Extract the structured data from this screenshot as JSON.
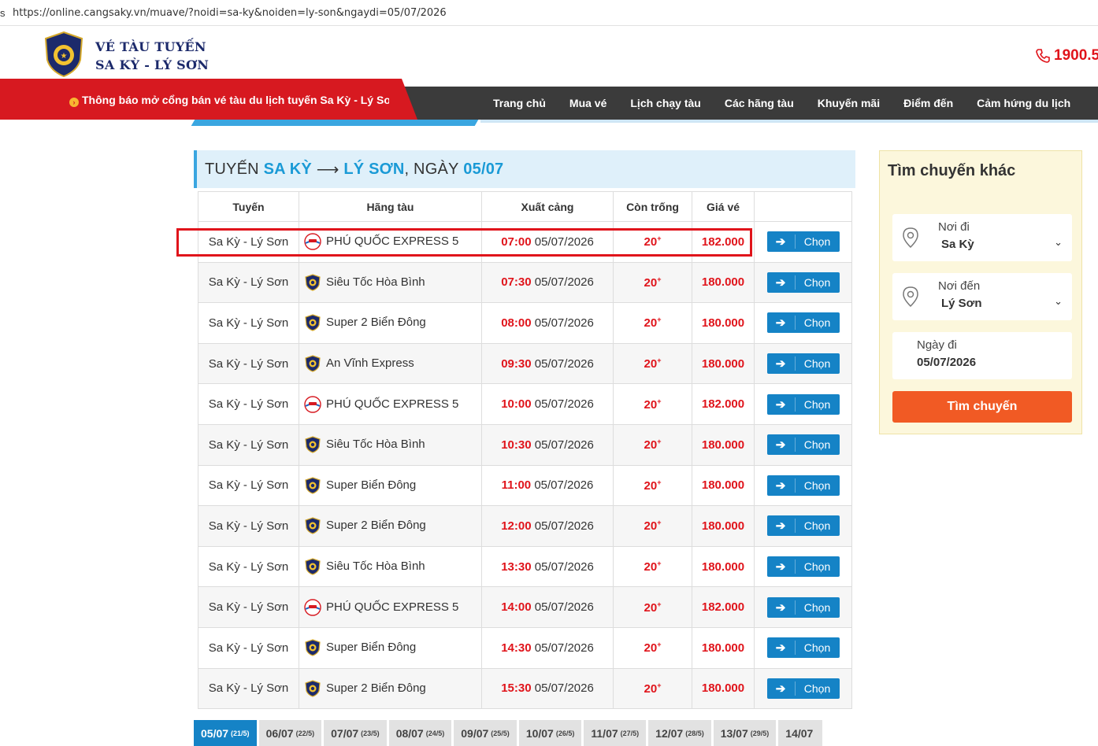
{
  "browser": {
    "url": "https://online.cangsaky.vn/muave/?noidi=sa-ky&noiden=ly-son&ngaydi=05/07/2026"
  },
  "brand": {
    "line1": "VÉ TÀU TUYẾN",
    "line2": "SA KỲ - LÝ SƠN",
    "hotline": "1900.5"
  },
  "notice": "Thông báo mở cổng bán vé tàu du lịch tuyến Sa Kỳ - Lý Sơn",
  "nav": [
    "Trang chủ",
    "Mua vé",
    "Lịch chạy tàu",
    "Các hãng tàu",
    "Khuyến mãi",
    "Điểm đến",
    "Cảm hứng du lịch"
  ],
  "route_title": {
    "prefix": "TUYẾN",
    "from": "SA KỲ",
    "arrow": "⟶",
    "to": "LÝ SƠN",
    "mid": ", NGÀY",
    "date": "05/07"
  },
  "table": {
    "headers": [
      "Tuyến",
      "Hãng tàu",
      "Xuất cảng",
      "Còn trống",
      "Giá vé"
    ],
    "select_label": "Chọn",
    "rows": [
      {
        "route": "Sa Kỳ - Lý Sơn",
        "operator": "PHÚ QUỐC EXPRESS 5",
        "logo": "pq-logo-icon",
        "time": "07:00",
        "date": "05/07/2026",
        "seats": "20",
        "price": "182.000"
      },
      {
        "route": "Sa Kỳ - Lý Sơn",
        "operator": "Siêu Tốc Hòa Bình",
        "logo": "shield-logo-icon",
        "time": "07:30",
        "date": "05/07/2026",
        "seats": "20",
        "price": "180.000"
      },
      {
        "route": "Sa Kỳ - Lý Sơn",
        "operator": "Super 2 Biển Đông",
        "logo": "shield-logo-icon",
        "time": "08:00",
        "date": "05/07/2026",
        "seats": "20",
        "price": "180.000"
      },
      {
        "route": "Sa Kỳ - Lý Sơn",
        "operator": "An Vĩnh Express",
        "logo": "shield-logo-icon",
        "time": "09:30",
        "date": "05/07/2026",
        "seats": "20",
        "price": "180.000"
      },
      {
        "route": "Sa Kỳ - Lý Sơn",
        "operator": "PHÚ QUỐC EXPRESS 5",
        "logo": "pq-logo-icon",
        "time": "10:00",
        "date": "05/07/2026",
        "seats": "20",
        "price": "182.000"
      },
      {
        "route": "Sa Kỳ - Lý Sơn",
        "operator": "Siêu Tốc Hòa Bình",
        "logo": "shield-logo-icon",
        "time": "10:30",
        "date": "05/07/2026",
        "seats": "20",
        "price": "180.000"
      },
      {
        "route": "Sa Kỳ - Lý Sơn",
        "operator": "Super Biển Đông",
        "logo": "shield-logo-icon",
        "time": "11:00",
        "date": "05/07/2026",
        "seats": "20",
        "price": "180.000"
      },
      {
        "route": "Sa Kỳ - Lý Sơn",
        "operator": "Super 2 Biển Đông",
        "logo": "shield-logo-icon",
        "time": "12:00",
        "date": "05/07/2026",
        "seats": "20",
        "price": "180.000"
      },
      {
        "route": "Sa Kỳ - Lý Sơn",
        "operator": "Siêu Tốc Hòa Bình",
        "logo": "shield-logo-icon",
        "time": "13:30",
        "date": "05/07/2026",
        "seats": "20",
        "price": "180.000"
      },
      {
        "route": "Sa Kỳ - Lý Sơn",
        "operator": "PHÚ QUỐC EXPRESS 5",
        "logo": "pq-logo-icon",
        "time": "14:00",
        "date": "05/07/2026",
        "seats": "20",
        "price": "182.000"
      },
      {
        "route": "Sa Kỳ - Lý Sơn",
        "operator": "Super Biển Đông",
        "logo": "shield-logo-icon",
        "time": "14:30",
        "date": "05/07/2026",
        "seats": "20",
        "price": "180.000"
      },
      {
        "route": "Sa Kỳ - Lý Sơn",
        "operator": "Super 2 Biển Đông",
        "logo": "shield-logo-icon",
        "time": "15:30",
        "date": "05/07/2026",
        "seats": "20",
        "price": "180.000"
      }
    ]
  },
  "date_tabs": [
    {
      "date": "05/07",
      "lunar": "(21/5)",
      "active": true
    },
    {
      "date": "06/07",
      "lunar": "(22/5)"
    },
    {
      "date": "07/07",
      "lunar": "(23/5)"
    },
    {
      "date": "08/07",
      "lunar": "(24/5)"
    },
    {
      "date": "09/07",
      "lunar": "(25/5)"
    },
    {
      "date": "10/07",
      "lunar": "(26/5)"
    },
    {
      "date": "11/07",
      "lunar": "(27/5)"
    },
    {
      "date": "12/07",
      "lunar": "(28/5)"
    },
    {
      "date": "13/07",
      "lunar": "(29/5)"
    },
    {
      "date": "14/07",
      "lunar": ""
    }
  ],
  "sidebar": {
    "title": "Tìm chuyến khác",
    "from_label": "Nơi đi",
    "from_value": "Sa Kỳ",
    "to_label": "Nơi đến",
    "to_value": "Lý Sơn",
    "date_label": "Ngày đi",
    "date_value": "05/07/2026",
    "search_label": "Tìm chuyến"
  },
  "colors": {
    "brand_navy": "#1c2a6b",
    "red": "#e0141b",
    "blue": "#1583c6",
    "orange": "#f15a24",
    "nav_dark": "#3b3b3b"
  }
}
